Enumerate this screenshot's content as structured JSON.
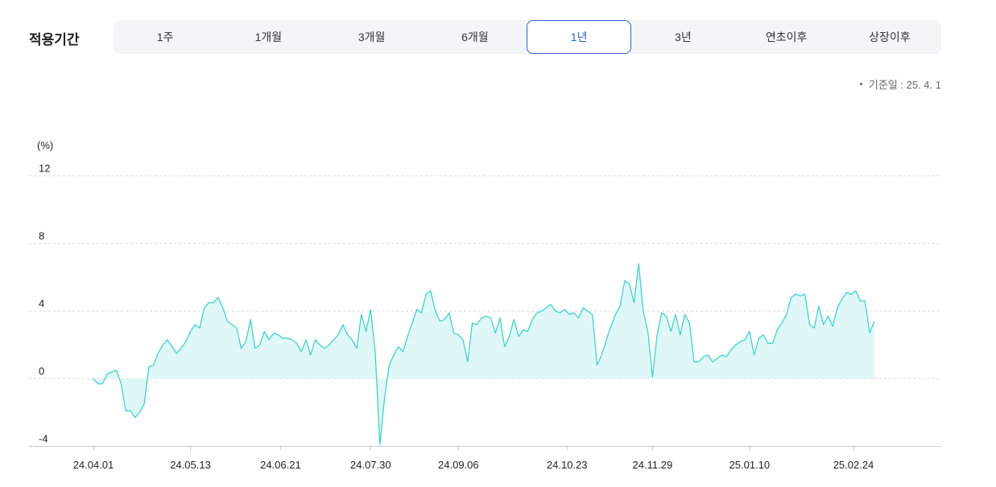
{
  "filter": {
    "label": "적용기간",
    "tabs": [
      "1주",
      "1개월",
      "3개월",
      "6개월",
      "1년",
      "3년",
      "연초이후",
      "상장이후"
    ],
    "active_index": 4
  },
  "base_date": "기준일 : 25. 4. 1",
  "colors": {
    "line": "#2dd4c8",
    "fill": "#dff7f7",
    "active": "#2f5fd0",
    "grid": "#dcdcdc"
  },
  "chart_data": {
    "type": "area",
    "title": "",
    "xlabel": "",
    "ylabel": "(%)",
    "ylim": [
      -4,
      12
    ],
    "yticks": [
      12,
      8,
      4,
      0,
      -4
    ],
    "grid": true,
    "xtick_labels": [
      "24.04.01",
      "24.05.13",
      "24.06.21",
      "24.07.30",
      "24.09.06",
      "24.10.23",
      "24.11.29",
      "25.01.10",
      "25.02.24"
    ],
    "points": [
      [
        "2024-04-01",
        0.0
      ],
      [
        "2024-04-03",
        -0.3
      ],
      [
        "2024-04-05",
        -0.3
      ],
      [
        "2024-04-07",
        0.3
      ],
      [
        "2024-04-09",
        0.4
      ],
      [
        "2024-04-11",
        0.5
      ],
      [
        "2024-04-13",
        -0.3
      ],
      [
        "2024-04-15",
        -1.9
      ],
      [
        "2024-04-17",
        -1.9
      ],
      [
        "2024-04-19",
        -2.3
      ],
      [
        "2024-04-21",
        -2.0
      ],
      [
        "2024-04-23",
        -1.5
      ],
      [
        "2024-04-25",
        0.7
      ],
      [
        "2024-04-27",
        0.8
      ],
      [
        "2024-04-29",
        1.5
      ],
      [
        "2024-05-01",
        2.0
      ],
      [
        "2024-05-03",
        2.3
      ],
      [
        "2024-05-05",
        1.9
      ],
      [
        "2024-05-07",
        1.5
      ],
      [
        "2024-05-09",
        1.8
      ],
      [
        "2024-05-11",
        2.2
      ],
      [
        "2024-05-13",
        2.8
      ],
      [
        "2024-05-15",
        3.2
      ],
      [
        "2024-05-17",
        3.0
      ],
      [
        "2024-05-19",
        4.2
      ],
      [
        "2024-05-21",
        4.5
      ],
      [
        "2024-05-23",
        4.5
      ],
      [
        "2024-05-25",
        4.8
      ],
      [
        "2024-05-27",
        4.2
      ],
      [
        "2024-05-29",
        3.4
      ],
      [
        "2024-05-31",
        3.2
      ],
      [
        "2024-06-02",
        3.0
      ],
      [
        "2024-06-04",
        1.8
      ],
      [
        "2024-06-06",
        2.2
      ],
      [
        "2024-06-08",
        3.5
      ],
      [
        "2024-06-10",
        1.8
      ],
      [
        "2024-06-12",
        2.0
      ],
      [
        "2024-06-14",
        2.8
      ],
      [
        "2024-06-16",
        2.3
      ],
      [
        "2024-06-18",
        2.7
      ],
      [
        "2024-06-20",
        2.6
      ],
      [
        "2024-06-22",
        2.4
      ],
      [
        "2024-06-24",
        2.4
      ],
      [
        "2024-06-26",
        2.3
      ],
      [
        "2024-06-28",
        2.1
      ],
      [
        "2024-06-30",
        1.6
      ],
      [
        "2024-07-02",
        2.3
      ],
      [
        "2024-07-04",
        1.4
      ],
      [
        "2024-07-06",
        2.3
      ],
      [
        "2024-07-08",
        2.0
      ],
      [
        "2024-07-10",
        1.8
      ],
      [
        "2024-07-12",
        2.0
      ],
      [
        "2024-07-14",
        2.3
      ],
      [
        "2024-07-16",
        2.6
      ],
      [
        "2024-07-18",
        3.2
      ],
      [
        "2024-07-20",
        2.6
      ],
      [
        "2024-07-22",
        2.3
      ],
      [
        "2024-07-24",
        1.8
      ],
      [
        "2024-07-26",
        3.8
      ],
      [
        "2024-07-28",
        2.8
      ],
      [
        "2024-07-30",
        4.1
      ],
      [
        "2024-08-01",
        1.5
      ],
      [
        "2024-08-03",
        -3.9
      ],
      [
        "2024-08-05",
        -1.2
      ],
      [
        "2024-08-07",
        0.8
      ],
      [
        "2024-08-09",
        1.4
      ],
      [
        "2024-08-11",
        1.9
      ],
      [
        "2024-08-13",
        1.6
      ],
      [
        "2024-08-15",
        2.5
      ],
      [
        "2024-08-17",
        3.3
      ],
      [
        "2024-08-19",
        4.1
      ],
      [
        "2024-08-21",
        3.9
      ],
      [
        "2024-08-23",
        5.0
      ],
      [
        "2024-08-25",
        5.2
      ],
      [
        "2024-08-27",
        4.0
      ],
      [
        "2024-08-29",
        3.4
      ],
      [
        "2024-08-31",
        3.5
      ],
      [
        "2024-09-02",
        3.9
      ],
      [
        "2024-09-04",
        2.7
      ],
      [
        "2024-09-06",
        2.6
      ],
      [
        "2024-09-08",
        2.3
      ],
      [
        "2024-09-10",
        1.0
      ],
      [
        "2024-09-12",
        3.3
      ],
      [
        "2024-09-14",
        3.2
      ],
      [
        "2024-09-16",
        3.6
      ],
      [
        "2024-09-18",
        3.7
      ],
      [
        "2024-09-20",
        3.6
      ],
      [
        "2024-09-22",
        2.7
      ],
      [
        "2024-09-24",
        3.6
      ],
      [
        "2024-09-26",
        1.9
      ],
      [
        "2024-09-28",
        2.5
      ],
      [
        "2024-09-30",
        3.5
      ],
      [
        "2024-10-02",
        2.5
      ],
      [
        "2024-10-04",
        2.9
      ],
      [
        "2024-10-06",
        2.8
      ],
      [
        "2024-10-08",
        3.5
      ],
      [
        "2024-10-10",
        3.9
      ],
      [
        "2024-10-12",
        4.0
      ],
      [
        "2024-10-14",
        4.2
      ],
      [
        "2024-10-16",
        4.4
      ],
      [
        "2024-10-18",
        4.0
      ],
      [
        "2024-10-20",
        3.9
      ],
      [
        "2024-10-22",
        4.1
      ],
      [
        "2024-10-24",
        3.8
      ],
      [
        "2024-10-26",
        3.9
      ],
      [
        "2024-10-28",
        3.6
      ],
      [
        "2024-10-30",
        4.2
      ],
      [
        "2024-11-01",
        4.0
      ],
      [
        "2024-11-03",
        3.8
      ],
      [
        "2024-11-05",
        0.8
      ],
      [
        "2024-11-07",
        1.4
      ],
      [
        "2024-11-09",
        2.3
      ],
      [
        "2024-11-11",
        3.1
      ],
      [
        "2024-11-13",
        3.8
      ],
      [
        "2024-11-15",
        4.3
      ],
      [
        "2024-11-17",
        5.8
      ],
      [
        "2024-11-19",
        5.6
      ],
      [
        "2024-11-21",
        4.5
      ],
      [
        "2024-11-23",
        6.8
      ],
      [
        "2024-11-25",
        4.0
      ],
      [
        "2024-11-27",
        2.8
      ],
      [
        "2024-11-29",
        0.1
      ],
      [
        "2024-12-01",
        2.6
      ],
      [
        "2024-12-03",
        3.9
      ],
      [
        "2024-12-05",
        3.7
      ],
      [
        "2024-12-07",
        2.8
      ],
      [
        "2024-12-09",
        3.8
      ],
      [
        "2024-12-11",
        2.6
      ],
      [
        "2024-12-13",
        3.8
      ],
      [
        "2024-12-15",
        3.3
      ],
      [
        "2024-12-17",
        1.0
      ],
      [
        "2024-12-19",
        1.0
      ],
      [
        "2024-12-21",
        1.3
      ],
      [
        "2024-12-23",
        1.4
      ],
      [
        "2024-12-25",
        1.0
      ],
      [
        "2024-12-27",
        1.2
      ],
      [
        "2024-12-29",
        1.4
      ],
      [
        "2024-12-31",
        1.3
      ],
      [
        "2025-01-02",
        1.7
      ],
      [
        "2025-01-04",
        2.0
      ],
      [
        "2025-01-06",
        2.2
      ],
      [
        "2025-01-08",
        2.3
      ],
      [
        "2025-01-10",
        2.8
      ],
      [
        "2025-01-12",
        1.4
      ],
      [
        "2025-01-14",
        2.4
      ],
      [
        "2025-01-16",
        2.6
      ],
      [
        "2025-01-18",
        2.1
      ],
      [
        "2025-01-20",
        2.1
      ],
      [
        "2025-01-22",
        2.9
      ],
      [
        "2025-01-24",
        3.3
      ],
      [
        "2025-01-26",
        3.8
      ],
      [
        "2025-01-28",
        4.8
      ],
      [
        "2025-01-30",
        5.0
      ],
      [
        "2025-02-01",
        4.9
      ],
      [
        "2025-02-03",
        5.0
      ],
      [
        "2025-02-05",
        3.2
      ],
      [
        "2025-02-07",
        3.0
      ],
      [
        "2025-02-09",
        4.3
      ],
      [
        "2025-02-11",
        3.2
      ],
      [
        "2025-02-13",
        3.7
      ],
      [
        "2025-02-15",
        3.1
      ],
      [
        "2025-02-17",
        4.2
      ],
      [
        "2025-02-19",
        4.7
      ],
      [
        "2025-02-21",
        5.1
      ],
      [
        "2025-02-23",
        5.0
      ],
      [
        "2025-02-25",
        5.2
      ],
      [
        "2025-02-27",
        4.6
      ],
      [
        "2025-03-01",
        4.6
      ],
      [
        "2025-03-03",
        2.7
      ],
      [
        "2025-03-05",
        3.4
      ]
    ]
  }
}
